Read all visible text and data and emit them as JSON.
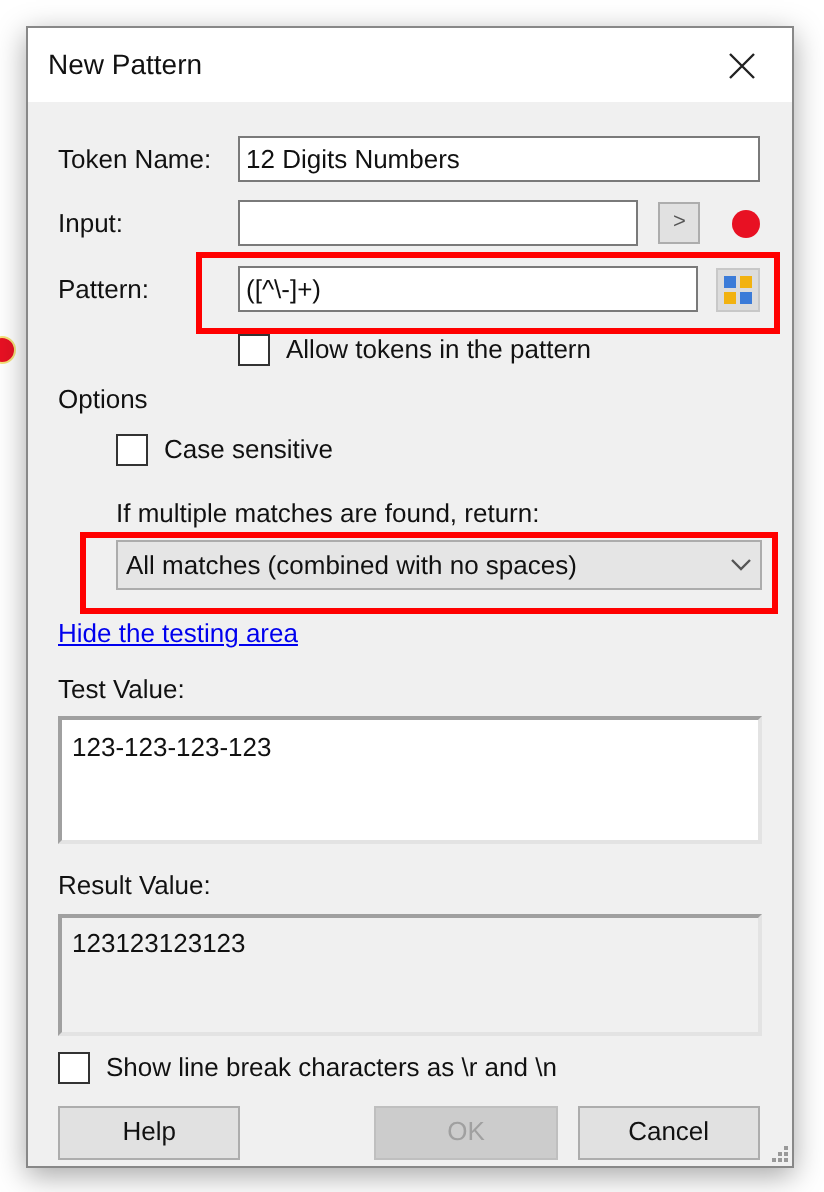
{
  "window": {
    "title": "New Pattern"
  },
  "fields": [
    {
      "kind": "text",
      "label": "Token Name:",
      "value": "12 Digits Numbers"
    },
    {
      "kind": "input",
      "label": "Input:",
      "button_label": ">",
      "error": true
    },
    {
      "kind": "pattern",
      "label": "Pattern:",
      "value": "([^\\-]+)",
      "highlighted": true
    }
  ],
  "allow_tokens": {
    "label": "Allow tokens in the pattern",
    "checked": false
  },
  "options": {
    "title": "Options",
    "case_sensitive": {
      "label": "Case sensitive",
      "checked": false
    },
    "multiple_label": "If multiple matches are found, return:",
    "dropdown": {
      "value": "All matches (combined with no spaces)",
      "highlighted": true
    }
  },
  "toggle_link": "Hide the testing area",
  "test_value": {
    "label": "Test Value:",
    "value": "123-123-123-123"
  },
  "result_value": {
    "label": "Result Value:",
    "value": "123123123123"
  },
  "show_line_breaks": {
    "label": "Show line break characters as \\r and \\n",
    "checked": false
  },
  "buttons": [
    {
      "label": "Help",
      "disabled": false
    },
    {
      "label": "OK",
      "disabled": true
    },
    {
      "label": "Cancel",
      "disabled": false
    }
  ]
}
